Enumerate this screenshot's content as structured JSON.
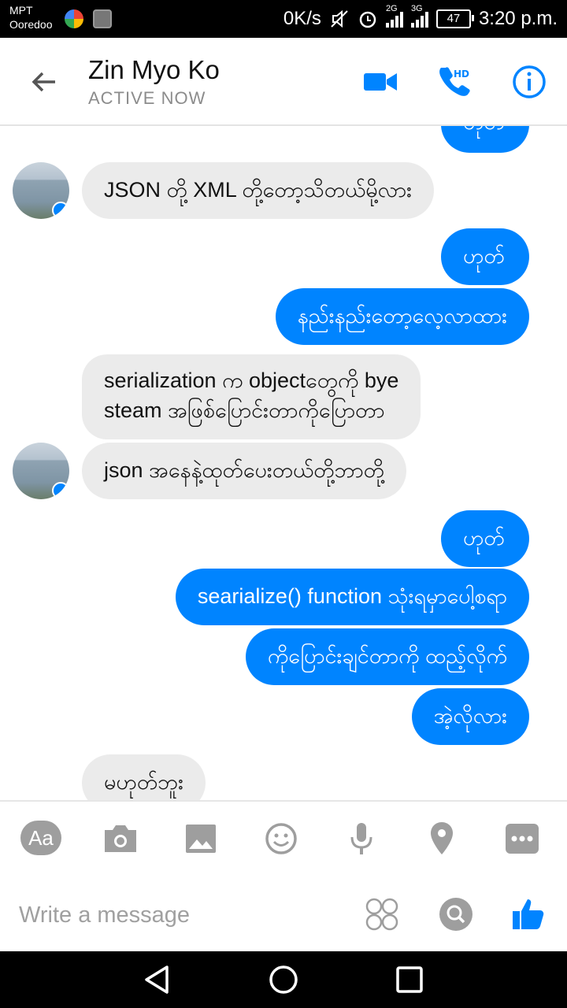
{
  "status_bar": {
    "carrier_line1": "MPT",
    "carrier_line2": "Ooredoo",
    "net_speed": "0K/s",
    "network_1": "2G",
    "network_2": "3G",
    "battery": "47",
    "time": "3:20 p.m."
  },
  "header": {
    "contact_name": "Zin Myo Ko",
    "contact_status": "ACTIVE NOW",
    "accent_color": "#0084ff"
  },
  "messages": [
    {
      "dir": "out",
      "text": "ဟုတ်"
    },
    {
      "dir": "in",
      "text": "JSON တို့ XML တို့တော့သိတယ်မို့လား"
    },
    {
      "dir": "out",
      "text": "ဟုတ်"
    },
    {
      "dir": "out",
      "text": "နည်းနည်းတော့လေ့လာထား"
    },
    {
      "dir": "in",
      "text_line1": "serialization  က objectတွေကို bye",
      "text_line2": "steam အဖြစ်ပြောင်းတာကိုပြောတာ"
    },
    {
      "dir": "in",
      "text": "json အနေနဲ့ထုတ်ပေးတယ်တို့ဘာတို့"
    },
    {
      "dir": "out",
      "text": "ဟုတ်"
    },
    {
      "dir": "out",
      "text": "searialize() function သုံးရမှာပေါ့စရာ"
    },
    {
      "dir": "out",
      "text": "ကိုပြောင်းချင်တာကို ထည့်လိုက်"
    },
    {
      "dir": "out",
      "text": "အဲ့လိုလား"
    },
    {
      "dir": "in",
      "text": "မဟုတ်ဘူး"
    }
  ],
  "composer": {
    "aa_label": "Aa",
    "placeholder": "Write a message"
  }
}
